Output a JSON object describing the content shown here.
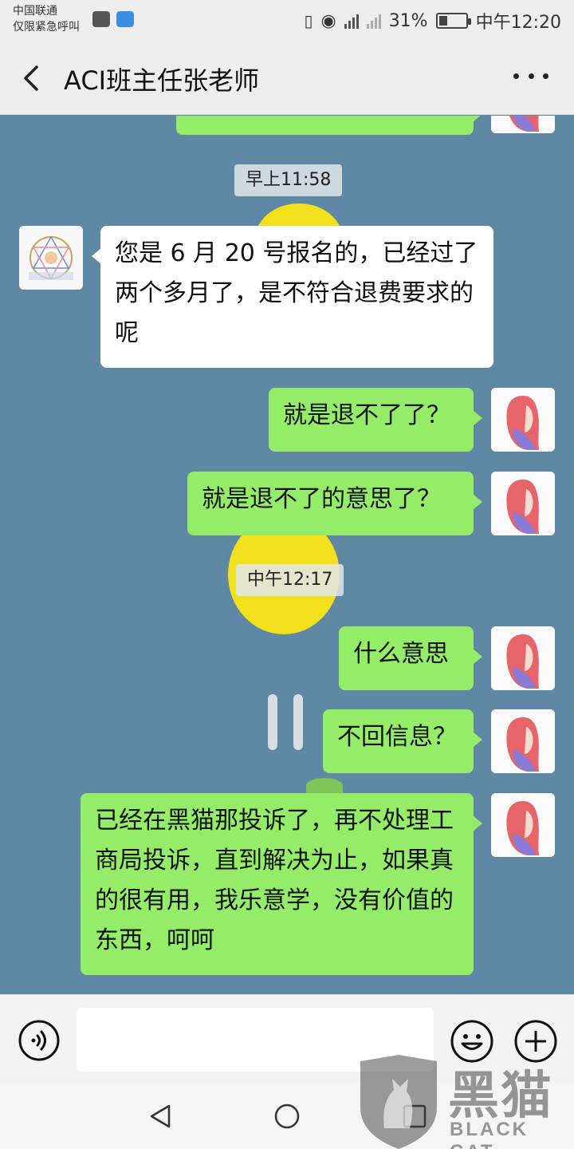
{
  "status_bar": {
    "carrier_line1": "中国联通",
    "carrier_line2": "仅限紧急呼叫",
    "battery": "31%",
    "battery_level": 0.31,
    "time": "中午12:20"
  },
  "header": {
    "title": "ACI班主任张老师"
  },
  "messages": [
    {
      "type": "time",
      "text": "早上11:58"
    },
    {
      "type": "received",
      "text": "您是 6 月 20 号报名的，已经过了两个多月了，是不符合退费要求的呢"
    },
    {
      "type": "sent",
      "text": "就是退不了了？"
    },
    {
      "type": "sent",
      "text": "就是退不了的意思了？"
    },
    {
      "type": "time",
      "text": "中午12:17"
    },
    {
      "type": "sent",
      "text": "什么意思"
    },
    {
      "type": "sent",
      "text": "不回信息？"
    },
    {
      "type": "sent",
      "text": "已经在黑猫那投诉了，再不处理工商局投诉，直到解决为止，如果真的很有用，我乐意学，没有价值的东西，呵呵"
    }
  ],
  "watermark": {
    "cn": "黑猫",
    "en": "BLACK CAT"
  },
  "colors": {
    "chat_background": "#5f88a5",
    "sent_bubble": "#95ec69",
    "received_bubble": "#ffffff",
    "bar_background": "#ededed"
  }
}
